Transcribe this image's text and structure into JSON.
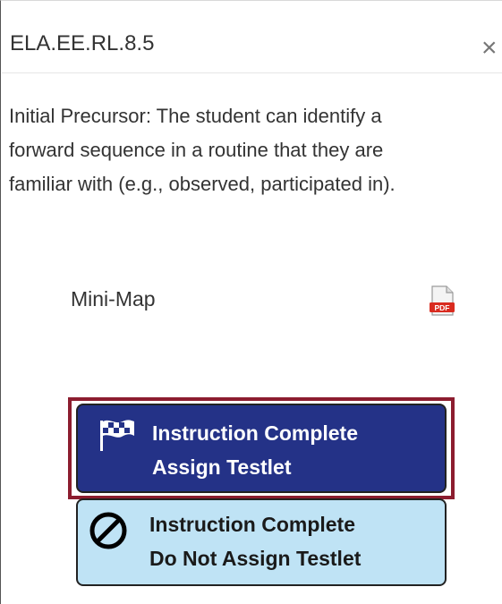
{
  "header": {
    "title": "ELA.EE.RL.8.5",
    "close_symbol": "×",
    "close_icon": "close-icon"
  },
  "description": {
    "lines": [
      "Initial Precursor: The student can identify a",
      "forward sequence in a routine that they are",
      "familiar with (e.g., observed, participated in)."
    ]
  },
  "mini_map": {
    "label": "Mini-Map",
    "icon": "pdf-icon",
    "icon_text": "PDF"
  },
  "buttons": {
    "assign": {
      "line1": "Instruction Complete",
      "line2": "Assign Testlet",
      "icon": "checkered-flag-icon",
      "bg_color": "#243287",
      "text_color": "#ffffff",
      "highlight_color": "#8c1d2f"
    },
    "no_assign": {
      "line1": "Instruction Complete",
      "line2": "Do Not Assign Testlet",
      "icon": "prohibited-icon",
      "bg_color": "#bfe3f5",
      "text_color": "#1a1a1a"
    }
  }
}
